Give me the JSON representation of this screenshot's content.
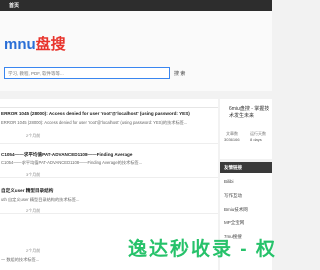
{
  "topbar": {
    "nav_home": "首页"
  },
  "logo": {
    "part1": "mnu",
    "part2": "盘搜"
  },
  "search": {
    "placeholder": "学习, 教程, PDF, 软件等等...",
    "button_label": "搜 索"
  },
  "list": {
    "heading": ""
  },
  "posts": [
    {
      "meta": "2个月前",
      "title": "ERROR 1045 (28000): Access denied for user 'root'@'localhost' (using password: YES)",
      "excerpt": "ERROR 1045 (28000): Access denied for user 'root'@'localhost' (using password: YES)的技术标签..."
    },
    {
      "meta": "3个月前",
      "title": "C1054——求平均值PAT-ADVANCED1108——Finding Average",
      "excerpt": "C1054——求平均值PAT-ADVANCED1108——Finding Average的技术标签..."
    },
    {
      "meta": "2个月前",
      "title": "自定义user 精型目录结构",
      "excerpt": "uth 自定义user 精型目录结构的技术标签..."
    },
    {
      "meta": "2个月前",
      "title": "",
      "excerpt": "一 数组的技术标签..."
    }
  ],
  "sidebar": {
    "site_title": "6miu盘搜 - 掌握技术发生未来",
    "stats": [
      {
        "label": "文章数",
        "value": "3036166"
      },
      {
        "label": "运行天数",
        "value": "8 days"
      }
    ],
    "tags_heading": "友情链接",
    "tags": [
      "Bilibi",
      "写作互动",
      "Bmiu技术网",
      "MP全宝网",
      "7mu搜搜"
    ]
  },
  "watermark": "逸达秒收录 - 权",
  "colors": {
    "accent": "#3a86f0",
    "logo_blue": "#2b6fd6",
    "logo_red": "#e8342c",
    "watermark": "#26c26a",
    "topbar": "#2d2d2d"
  }
}
